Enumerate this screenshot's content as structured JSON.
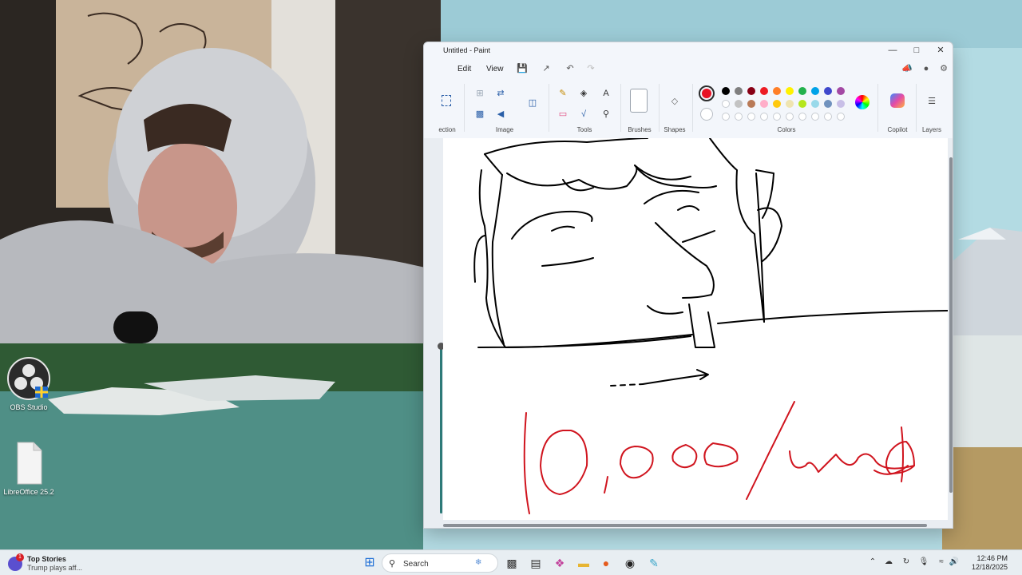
{
  "desktop": {
    "icons": [
      {
        "label": "OBS Studio",
        "icon": "obs-studio-icon"
      },
      {
        "label": "LibreOffice 25.2",
        "icon": "libreoffice-icon"
      }
    ]
  },
  "paint": {
    "title": "Untitled - Paint",
    "menu": {
      "edit": "Edit",
      "view": "View"
    },
    "groups": {
      "selection": "ection",
      "image": "Image",
      "tools": "Tools",
      "brushes": "Brushes",
      "shapes": "Shapes",
      "colors": "Colors",
      "copilot": "Copilot",
      "layers": "Layers"
    },
    "active_color": "#e81123",
    "palette_row1": [
      "#000000",
      "#7f7f7f",
      "#880015",
      "#ed1c24",
      "#ff7f27",
      "#fff200",
      "#22b14c",
      "#00a2e8",
      "#3f48cc",
      "#a349a4"
    ],
    "palette_row2": [
      "#ffffff",
      "#c3c3c3",
      "#b97a57",
      "#ffaec9",
      "#ffc90e",
      "#efe4b0",
      "#b5e61d",
      "#99d9ea",
      "#7092be",
      "#c8bfe7"
    ],
    "canvas_text": "10,000/week"
  },
  "taskbar": {
    "news_headline": "Top Stories",
    "news_sub": "Trump plays aff...",
    "news_badge": "1",
    "search_label": "Search",
    "time": "12:46 PM",
    "date": "12/18/2025"
  }
}
